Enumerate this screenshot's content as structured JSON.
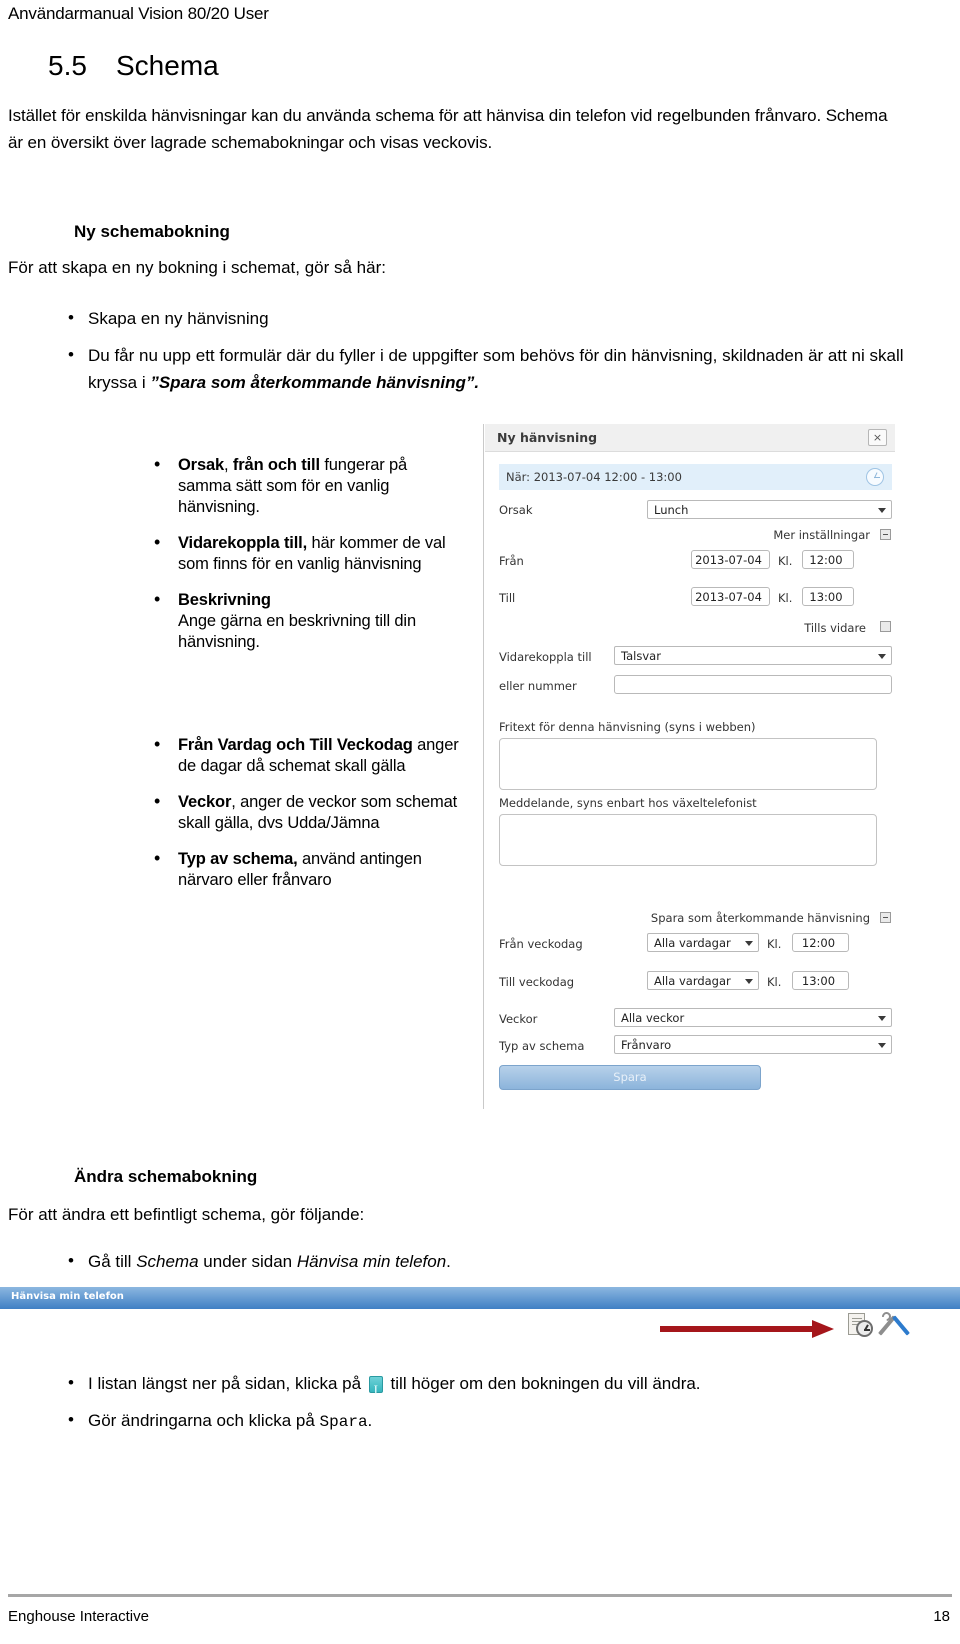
{
  "header": {
    "running_title": "Användarmanual Vision 80/20 User"
  },
  "section": {
    "number": "5.5",
    "title": "Schema"
  },
  "intro": "Istället för enskilda hänvisningar kan du använda schema för att hänvisa din telefon vid regelbunden frånvaro. Schema är en översikt över lagrade schemabokningar och visas veckovis.",
  "new_booking": {
    "heading": "Ny schemabokning",
    "lead": "För att skapa en ny bokning i schemat, gör så här:",
    "bullets": [
      "Skapa en ny hänvisning",
      "Du får nu upp ett formulär där du fyller i de uppgifter som behövs för din hänvisning, skildnaden är att ni skall kryssa i "
    ],
    "bullet2_emphasis": "”Spara som återkommande hänvisning”."
  },
  "annotations_top": [
    {
      "bold1": "Orsak",
      "plain1": ", ",
      "bold2": "från och till",
      "rest": " fungerar på samma sätt som för en vanlig hänvisning."
    },
    {
      "bold1": "Vidarekoppla till,",
      "rest": " här kommer de val som finns för en vanlig hänvisning"
    },
    {
      "bold1": "Beskrivning",
      "rest": "Ange gärna en beskrivning till din hänvisning."
    }
  ],
  "annotations_bottom": [
    {
      "bold1": "Från Vardag och Till Veckodag",
      "rest": " anger de dagar då schemat skall gälla"
    },
    {
      "bold1": "Veckor",
      "rest": ",  anger de veckor som schemat skall gälla, dvs Udda/Jämna"
    },
    {
      "bold1": "Typ av schema,",
      "rest": " använd antingen närvaro eller frånvaro"
    }
  ],
  "dialog": {
    "title": "Ny hänvisning",
    "close_label": "×",
    "when_text": "När: 2013-07-04 12:00 - 13:00",
    "orsak_label": "Orsak",
    "orsak_value": "Lunch",
    "more_settings_label": "Mer inställningar",
    "fran_label": "Från",
    "fran_date": "2013-07-04",
    "fran_kl_label": "Kl.",
    "fran_time": "12:00",
    "till_label": "Till",
    "till_date": "2013-07-04",
    "till_kl_label": "Kl.",
    "till_time": "13:00",
    "tills_vidare_label": "Tills vidare",
    "vidarekoppla_label": "Vidarekoppla till",
    "vidarekoppla_value": "Talsvar",
    "eller_nummer_label": "eller nummer",
    "eller_nummer_value": "",
    "fritext_label": "Fritext för denna hänvisning (syns i webben)",
    "fritext_value": "",
    "meddelande_label": "Meddelande, syns enbart hos växeltelefonist",
    "meddelande_value": "",
    "recurring_label": "Spara som återkommande hänvisning",
    "fran_veckodag_label": "Från veckodag",
    "fran_veckodag_value": "Alla vardagar",
    "fran_veckodag_kl_label": "Kl.",
    "fran_veckodag_time": "12:00",
    "till_veckodag_label": "Till veckodag",
    "till_veckodag_value": "Alla vardagar",
    "till_veckodag_kl_label": "Kl.",
    "till_veckodag_time": "13:00",
    "veckor_label": "Veckor",
    "veckor_value": "Alla veckor",
    "typ_label": "Typ av schema",
    "typ_value": "Frånvaro",
    "save_label": "Spara"
  },
  "edit_booking": {
    "heading": "Ändra schemabokning",
    "lead": "För att ändra ett befintligt schema, gör följande:",
    "bullet1_pre": "Gå till ",
    "bullet1_it1": "Schema",
    "bullet1_mid": " under sidan ",
    "bullet1_it2": "Hänvisa min telefon",
    "bullet1_post": ".",
    "bullet2_pre": "I listan längst ner på sidan, klicka på ",
    "bullet2_post": " till höger om den bokningen du vill ändra.",
    "bullet3_pre": "Gör ändringarna och klicka på ",
    "bullet3_code": "Spara",
    "bullet3_post": "."
  },
  "banner": {
    "title": "Hänvisa min telefon"
  },
  "footer": {
    "company": "Enghouse Interactive",
    "page": "18"
  },
  "colors": {
    "banner_blue": "#3f7fc4",
    "arrow_red": "#a5161b",
    "highlight_blue": "#e1effa"
  }
}
